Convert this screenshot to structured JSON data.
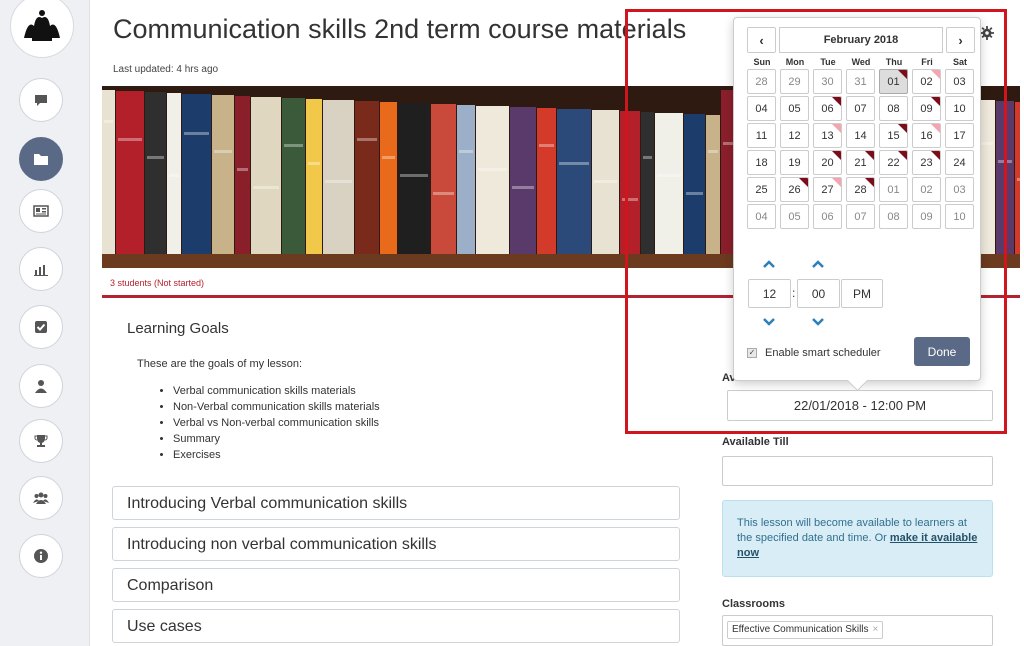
{
  "page": {
    "title": "Communication skills 2nd term course materials",
    "last_updated": "Last updated: 4 hrs ago",
    "students_status": "3 students (Not started)"
  },
  "rail": {
    "items": [
      {
        "name": "chat",
        "icon": "speech-bubble-icon"
      },
      {
        "name": "materials",
        "icon": "folder-icon",
        "active": true
      },
      {
        "name": "news",
        "icon": "newspaper-icon"
      },
      {
        "name": "reports",
        "icon": "bar-chart-icon"
      },
      {
        "name": "tasks",
        "icon": "checkbox-icon"
      },
      {
        "name": "profile",
        "icon": "user-icon"
      },
      {
        "name": "awards",
        "icon": "trophy-icon"
      },
      {
        "name": "groups",
        "icon": "users-icon"
      },
      {
        "name": "info",
        "icon": "info-icon"
      }
    ]
  },
  "learning_goals": {
    "heading": "Learning Goals",
    "intro": "These are the goals of my lesson:",
    "items": [
      "Verbal communication skills materials",
      "Non-Verbal communication skills materials",
      "Verbal vs Non-verbal communication skills",
      "Summary",
      "Exercises"
    ]
  },
  "sections": [
    "Introducing Verbal communication skills",
    "Introducing non verbal communication skills",
    "Comparison",
    "Use cases"
  ],
  "availability": {
    "from_label": "Available From",
    "from_value": "22/01/2018 - 12:00 PM",
    "till_label": "Available Till",
    "till_value": "",
    "info_text": "This lesson will become available to learners at the specified date and time. Or",
    "info_link": "make it available now",
    "classrooms_label": "Classrooms",
    "classroom_tag": "Effective Communication Skills",
    "tag_remove": "×"
  },
  "picker": {
    "prev": "‹",
    "next": "›",
    "month_label": "February 2018",
    "weekdays": [
      "Sun",
      "Mon",
      "Tue",
      "Wed",
      "Thu",
      "Fri",
      "Sat"
    ],
    "weeks": [
      [
        "28",
        "29",
        "30",
        "31",
        "01",
        "02",
        "03"
      ],
      [
        "04",
        "05",
        "06",
        "07",
        "08",
        "09",
        "10"
      ],
      [
        "11",
        "12",
        "13",
        "14",
        "15",
        "16",
        "17"
      ],
      [
        "18",
        "19",
        "20",
        "21",
        "22",
        "23",
        "24"
      ],
      [
        "25",
        "26",
        "27",
        "28",
        "01",
        "02",
        "03"
      ],
      [
        "04",
        "05",
        "06",
        "07",
        "08",
        "09",
        "10"
      ]
    ],
    "hour": "12",
    "minute": "00",
    "meridiem": "PM",
    "smart_label": "Enable smart scheduler",
    "smart_checked": true,
    "done_label": "Done"
  },
  "colors": {
    "accent": "#5a6a86",
    "highlight_border": "#d0151f",
    "red_line": "#b5222f",
    "info_bg": "#d9edf7"
  }
}
